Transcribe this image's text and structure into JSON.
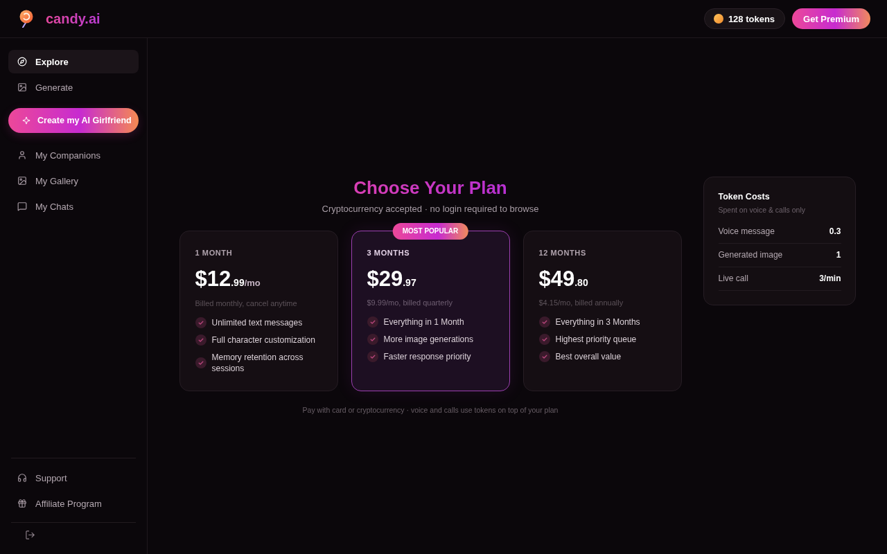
{
  "header": {
    "brand": "candy.ai",
    "tokens": "128 tokens",
    "premium_button": "Get Premium"
  },
  "sidebar": {
    "nav": [
      {
        "label": "Explore",
        "selected": true
      },
      {
        "label": "Generate",
        "selected": false
      }
    ],
    "create_button": "Create my AI Girlfriend",
    "library": [
      {
        "label": "My Companions",
        "selected": false
      },
      {
        "label": "My Gallery",
        "selected": false
      },
      {
        "label": "My Chats",
        "selected": false
      }
    ],
    "footer_links": [
      {
        "label": "Support",
        "selected": false
      },
      {
        "label": "Affiliate Program",
        "selected": false
      }
    ]
  },
  "pricing": {
    "title": "Choose Your Plan",
    "subtitle": "Cryptocurrency accepted · no login required to browse",
    "plans": [
      {
        "label": "1 MONTH",
        "price": "$12",
        "cents": ".99",
        "period": "/mo",
        "note": "Billed monthly, cancel anytime",
        "selected": false,
        "features": [
          "Unlimited text messages",
          "Full character customization",
          "Memory retention across sessions"
        ]
      },
      {
        "label": "3 MONTHS",
        "badge": "MOST POPULAR",
        "price": "$29",
        "cents": ".97",
        "note": "$9.99/mo, billed quarterly",
        "selected": true,
        "features": [
          "Everything in 1 Month",
          "More image generations",
          "Faster response priority"
        ]
      },
      {
        "label": "12 MONTHS",
        "price": "$49",
        "cents": ".80",
        "note": "$4.15/mo, billed annually",
        "selected": false,
        "features": [
          "Everything in 3 Months",
          "Highest priority queue",
          "Best overall value"
        ]
      }
    ],
    "footnote": "Pay with card or cryptocurrency · voice and calls use tokens on top of your plan"
  },
  "token_costs": {
    "title": "Token Costs",
    "subtitle": "Spent on voice & calls only",
    "rows": [
      {
        "label": "Voice message",
        "value": "0.3"
      },
      {
        "label": "Generated image",
        "value": "1"
      },
      {
        "label": "Live call",
        "value": "3/min"
      }
    ]
  }
}
